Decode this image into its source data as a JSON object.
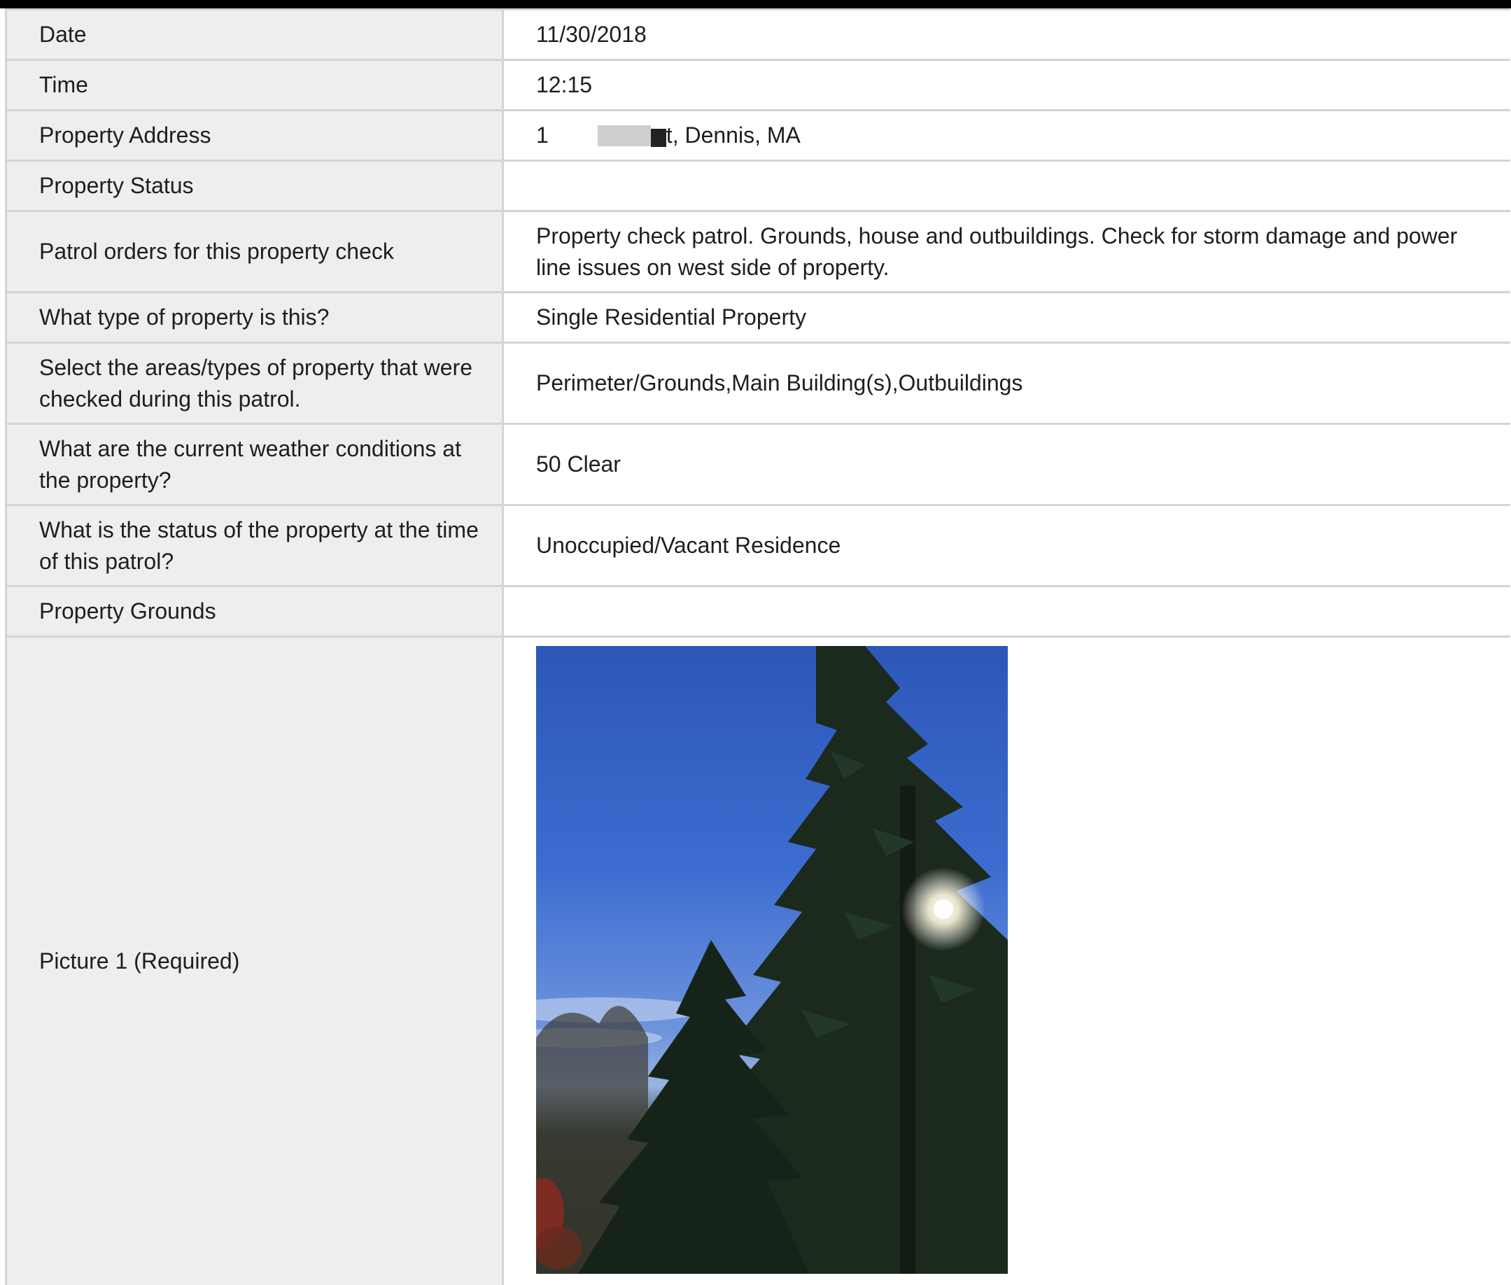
{
  "rows": [
    {
      "label": "Date",
      "value": "11/30/2018"
    },
    {
      "label": "Time",
      "value": "12:15"
    },
    {
      "label": "Property Address",
      "value_start": "1",
      "value_end": "t, Dennis, MA"
    },
    {
      "label": "Property Status",
      "value": ""
    },
    {
      "label": "Patrol orders for this property check",
      "value": "Property check patrol. Grounds, house and outbuildings. Check for storm damage and power line issues on west side of property."
    },
    {
      "label": "What type of property is this?",
      "value": "Single Residential Property"
    },
    {
      "label": "Select the areas/types of property that were checked during this patrol.",
      "value": "Perimeter/Grounds,Main Building(s),Outbuildings"
    },
    {
      "label": "What are the current weather conditions at the property?",
      "value": "50 Clear"
    },
    {
      "label": "What is the status of the property at the time of this patrol?",
      "value": "Unoccupied/Vacant Residence"
    },
    {
      "label": "Property Grounds",
      "value": ""
    },
    {
      "label": "Picture 1 (Required)"
    }
  ],
  "colors": {
    "label_bg": "#eeeeee",
    "border": "#d4d4d4",
    "top_bar": "#000000",
    "text": "#1e1e1e"
  },
  "icons": {
    "photo": "photo-pine-trees-sun"
  }
}
